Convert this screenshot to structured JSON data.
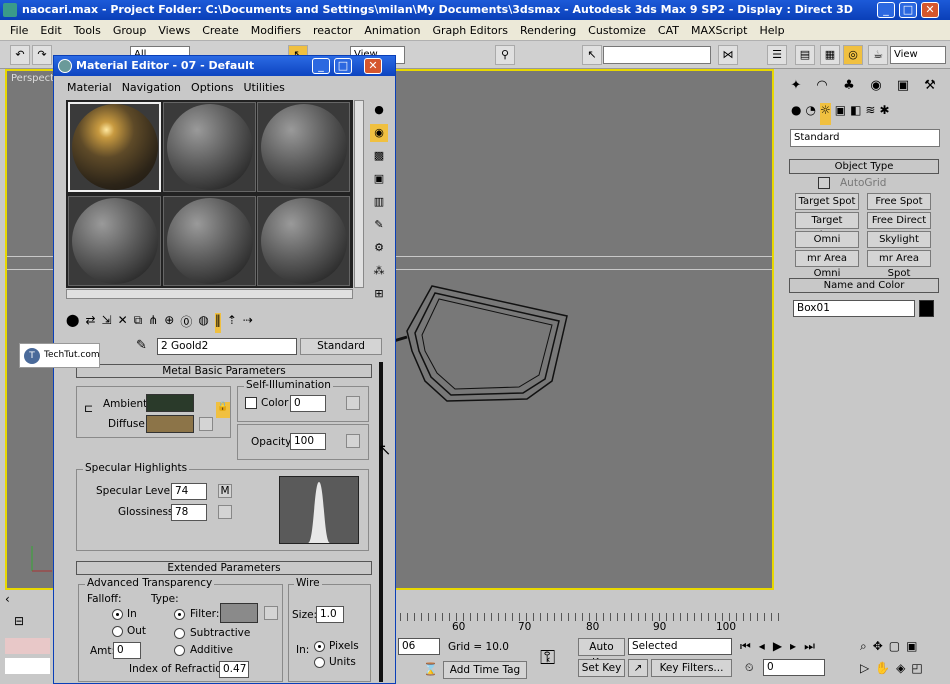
{
  "app": {
    "title": "naocari.max    - Project Folder: C:\\Documents and Settings\\milan\\My Documents\\3dsmax    - Autodesk 3ds Max 9 SP2    - Display : Direct 3D",
    "menu": [
      "File",
      "Edit",
      "Tools",
      "Group",
      "Views",
      "Create",
      "Modifiers",
      "reactor",
      "Animation",
      "Graph Editors",
      "Rendering",
      "Customize",
      "CAT",
      "MAXScript",
      "Help"
    ],
    "toolbar": {
      "selection_filter": "All",
      "ref_coord": "View",
      "named_sel": "",
      "view_dropdown": "View"
    }
  },
  "viewport": {
    "label": "Perspective",
    "ticks": [
      "60",
      "70",
      "80",
      "90",
      "100"
    ]
  },
  "command_panel": {
    "category": "Standard",
    "object_type_header": "Object Type",
    "autogrid": "AutoGrid",
    "buttons": [
      "Target Spot",
      "Free Spot",
      "Target Direct",
      "Free Direct",
      "Omni",
      "Skylight",
      "mr Area Omni",
      "mr Area Spot"
    ],
    "name_color_header": "Name and Color",
    "object_name": "Box01",
    "object_color": "#000000"
  },
  "material_editor": {
    "title": "Material Editor - 07 - Default",
    "menu": [
      "Material",
      "Navigation",
      "Options",
      "Utilities"
    ],
    "material_name": "2 Goold2",
    "material_type": "Standard",
    "metal_basic": {
      "header": "Metal Basic Parameters",
      "ambient_label": "Ambient:",
      "diffuse_label": "Diffuse:",
      "ambient_color": "#2a3a2a",
      "diffuse_color": "#8c7448",
      "self_illum_label": "Self-Illumination",
      "color_label": "Color",
      "color_value": "0",
      "opacity_label": "Opacity:",
      "opacity_value": "100"
    },
    "specular": {
      "header": "Specular Highlights",
      "level_label": "Specular Level:",
      "level_value": "74",
      "gloss_label": "Glossiness:",
      "gloss_value": "78",
      "m_button": "M"
    },
    "extended": {
      "header": "Extended Parameters",
      "adv_transparency": "Advanced Transparency",
      "falloff_label": "Falloff:",
      "type_label": "Type:",
      "falloff_in": "In",
      "falloff_out": "Out",
      "type_filter": "Filter:",
      "type_subtractive": "Subtractive",
      "type_additive": "Additive",
      "amt_label": "Amt:",
      "amt_value": "0",
      "ior_label": "Index of Refraction:",
      "ior_value": "0.47",
      "filter_color": "#8a8a8a",
      "wire_label": "Wire",
      "size_label": "Size:",
      "size_value": "1.0",
      "in_label": "In:",
      "pixels": "Pixels",
      "units": "Units"
    }
  },
  "status": {
    "frame_spinner": "06",
    "grid": "Grid = 10.0",
    "add_time_tag": "Add Time Tag",
    "auto_key": "Auto Key",
    "selected": "Selected",
    "set_key": "Set Key",
    "key_filters": "Key Filters...",
    "current_frame": "0"
  },
  "watermark": "TechTut.com"
}
